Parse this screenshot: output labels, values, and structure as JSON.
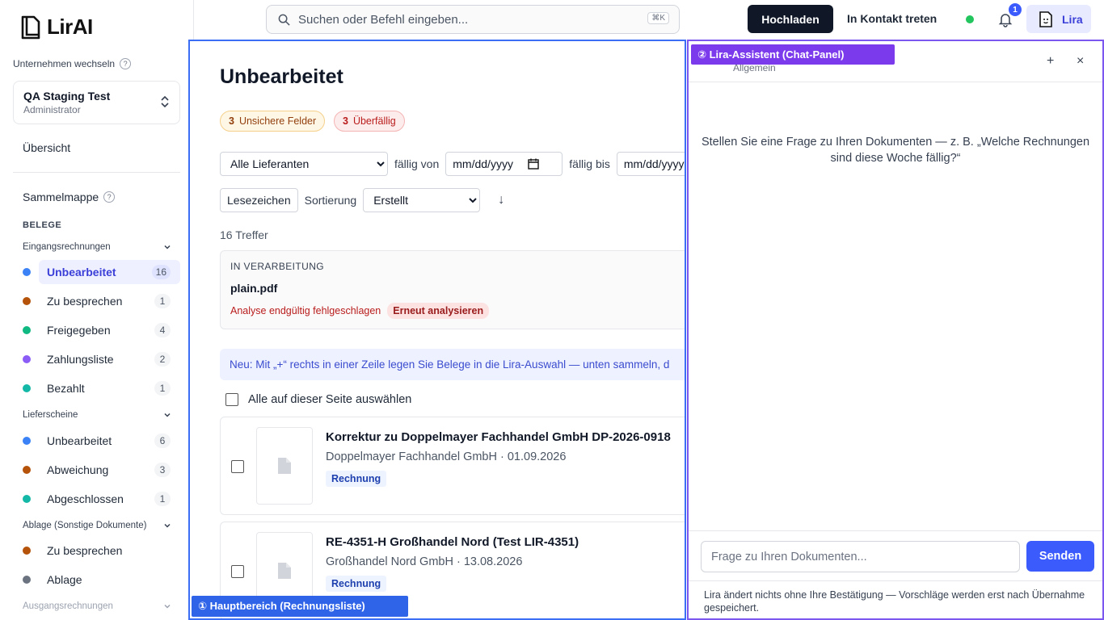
{
  "app": {
    "logo_text": "LirAI"
  },
  "sidebar": {
    "switch_label": "Unternehmen wechseln",
    "help_glyph": "?",
    "company": {
      "name": "QA Staging Test",
      "role": "Administrator"
    },
    "overview": "Übersicht",
    "sammelmappe": "Sammelmappe",
    "belege_header": "BELEGE",
    "groups": [
      {
        "label": "Eingangsrechnungen",
        "items": [
          {
            "label": "Unbearbeitet",
            "count": "16",
            "color": "#3b82f6",
            "active": true
          },
          {
            "label": "Zu besprechen",
            "count": "1",
            "color": "#b45309"
          },
          {
            "label": "Freigegeben",
            "count": "4",
            "color": "#10b981"
          },
          {
            "label": "Zahlungsliste",
            "count": "2",
            "color": "#8b5cf6"
          },
          {
            "label": "Bezahlt",
            "count": "1",
            "color": "#14b8a6"
          }
        ]
      },
      {
        "label": "Lieferscheine",
        "items": [
          {
            "label": "Unbearbeitet",
            "count": "6",
            "color": "#3b82f6"
          },
          {
            "label": "Abweichung",
            "count": "3",
            "color": "#b45309"
          },
          {
            "label": "Abgeschlossen",
            "count": "1",
            "color": "#14b8a6"
          }
        ]
      },
      {
        "label": "Ablage (Sonstige Dokumente)",
        "items": [
          {
            "label": "Zu besprechen",
            "color": "#b45309"
          },
          {
            "label": "Ablage",
            "color": "#6b7280"
          }
        ]
      },
      {
        "label": "Ausgangsrechnungen",
        "items": []
      }
    ]
  },
  "topbar": {
    "search_placeholder": "Suchen oder Befehl eingeben...",
    "shortcut": "⌘K",
    "upload": "Hochladen",
    "contact": "In Kontakt treten",
    "notif_count": "1",
    "lira": "Lira"
  },
  "main": {
    "title": "Unbearbeitet",
    "pills": {
      "unsure_count": "3",
      "unsure_label": "Unsichere Felder",
      "overdue_count": "3",
      "overdue_label": "Überfällig"
    },
    "filters": {
      "supplier": "Alle Lieferanten",
      "due_from": "fällig von",
      "due_to": "fällig bis",
      "date_placeholder": "mm/dd/yyyy"
    },
    "bookmarks": "Lesezeichen",
    "sort_label": "Sortierung",
    "sort_value": "Erstellt",
    "sort_dir": "↓",
    "hits": "16 Treffer",
    "processing": {
      "label": "IN VERARBEITUNG",
      "file": "plain.pdf",
      "error": "Analyse endgültig fehlgeschlagen",
      "retry": "Erneut analysieren"
    },
    "banner": "Neu: Mit „+“ rechts in einer Zeile legen Sie Belege in die Lira-Auswahl — unten sammeln, d",
    "select_all": "Alle auf dieser Seite auswählen",
    "invoices": [
      {
        "title": "Korrektur zu Doppelmayer Fachhandel GmbH DP-2026-0918",
        "sub": "Doppelmayer Fachhandel GmbH · 01.09.2026",
        "tag": "Rechnung"
      },
      {
        "title": "RE-4351-H Großhandel Nord (Test LIR-4351)",
        "sub": "Großhandel Nord GmbH · 13.08.2026",
        "tag": "Rechnung"
      }
    ],
    "region_tag": "① Hauptbereich (Rechnungsliste)"
  },
  "chat": {
    "region_tag": "② Lira-Assistent (Chat-Panel)",
    "subtitle": "Allgemein",
    "plus": "+",
    "close": "×",
    "empty": "Stellen Sie eine Frage zu Ihren Dokumenten — z. B. „Welche Rechnungen sind diese Woche fällig?“",
    "input_placeholder": "Frage zu Ihren Dokumenten...",
    "send": "Senden",
    "note": "Lira ändert nichts ohne Ihre Bestätigung — Vorschläge werden erst nach Übernahme gespeichert."
  }
}
